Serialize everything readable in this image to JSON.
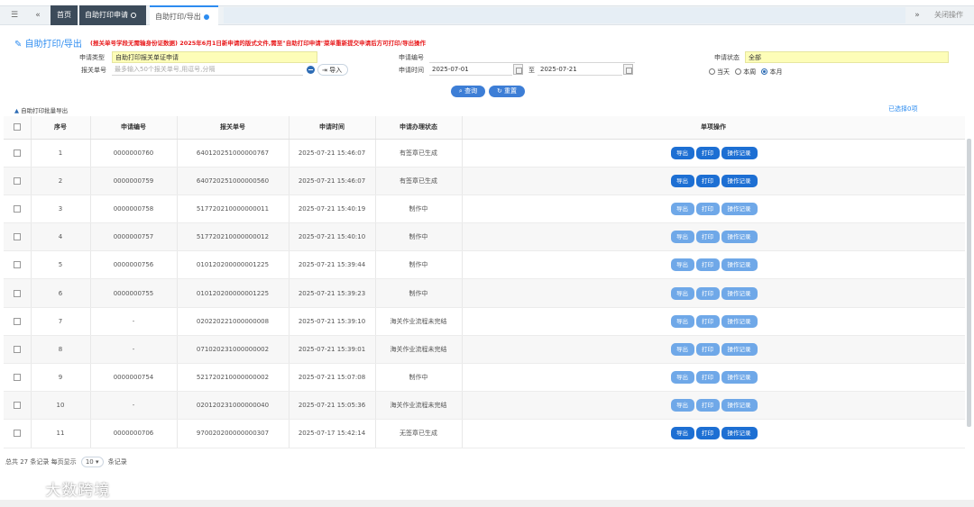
{
  "tabbar": {
    "menu_icon": "☰",
    "back_icon": "«",
    "home": "首页",
    "apply_tab": "自助打印申请",
    "current_tab": "自助打印/导出",
    "forward_icon": "»",
    "close_ops": "关闭操作"
  },
  "header": {
    "title": "自助打印/导出",
    "notice": "(报关单号学段无需输身份证数据)    2025年6月1日新申请的版式文件,需至\"自助打印申请\"菜单重新提交申请后方可打印/导出操作"
  },
  "form": {
    "type_label": "申请类型",
    "type_value": "自助打印报关单证申请",
    "declno_label": "报关单号",
    "declno_placeholder": "最多输入50个报关单号,用逗号,分隔",
    "import_label": "导入",
    "applyno_label": "申请编号",
    "time_label": "申请时间",
    "start_date": "2025-07-01",
    "to_label": "至",
    "end_date": "2025-07-21",
    "status_label": "申请状态",
    "status_value": "全部",
    "radio_today": "当天",
    "radio_week": "本周",
    "radio_month": "本月",
    "query_btn": "查询",
    "reset_btn": "重置",
    "export_all": "自助打印批量导出",
    "selected": "已选择0项"
  },
  "table": {
    "headers": [
      "序号",
      "申请编号",
      "报关单号",
      "申请时间",
      "申请办理状态",
      "单项操作"
    ],
    "op_export": "导出",
    "op_print": "打印",
    "op_log": "操作记录",
    "rows": [
      {
        "no": "1",
        "apply_no": "0000000760",
        "decl_no": "640120251000000767",
        "time": "2025-07-21 15:46:07",
        "status": "有签章已生成"
      },
      {
        "no": "2",
        "apply_no": "0000000759",
        "decl_no": "640720251000000560",
        "time": "2025-07-21 15:46:07",
        "status": "有签章已生成"
      },
      {
        "no": "3",
        "apply_no": "0000000758",
        "decl_no": "517720210000000011",
        "time": "2025-07-21 15:40:19",
        "status": "制作中"
      },
      {
        "no": "4",
        "apply_no": "0000000757",
        "decl_no": "517720210000000012",
        "time": "2025-07-21 15:40:10",
        "status": "制作中"
      },
      {
        "no": "5",
        "apply_no": "0000000756",
        "decl_no": "010120200000001225",
        "time": "2025-07-21 15:39:44",
        "status": "制作中"
      },
      {
        "no": "6",
        "apply_no": "0000000755",
        "decl_no": "010120200000001225",
        "time": "2025-07-21 15:39:23",
        "status": "制作中"
      },
      {
        "no": "7",
        "apply_no": "-",
        "decl_no": "020220221000000008",
        "time": "2025-07-21 15:39:10",
        "status": "海关作业流程未完结"
      },
      {
        "no": "8",
        "apply_no": "-",
        "decl_no": "071020231000000002",
        "time": "2025-07-21 15:39:01",
        "status": "海关作业流程未完结"
      },
      {
        "no": "9",
        "apply_no": "0000000754",
        "decl_no": "521720210000000002",
        "time": "2025-07-21 15:07:08",
        "status": "制作中"
      },
      {
        "no": "10",
        "apply_no": "-",
        "decl_no": "020120231000000040",
        "time": "2025-07-21 15:05:36",
        "status": "海关作业流程未完结"
      },
      {
        "no": "11",
        "apply_no": "0000000706",
        "decl_no": "970020200000000307",
        "time": "2025-07-17 15:42:14",
        "status": "无签章已生成"
      }
    ]
  },
  "footer": {
    "total_prefix": "总共 27 条记录  每页显示",
    "page_size": "10",
    "suffix": "条记录"
  },
  "watermark": "大数跨境"
}
